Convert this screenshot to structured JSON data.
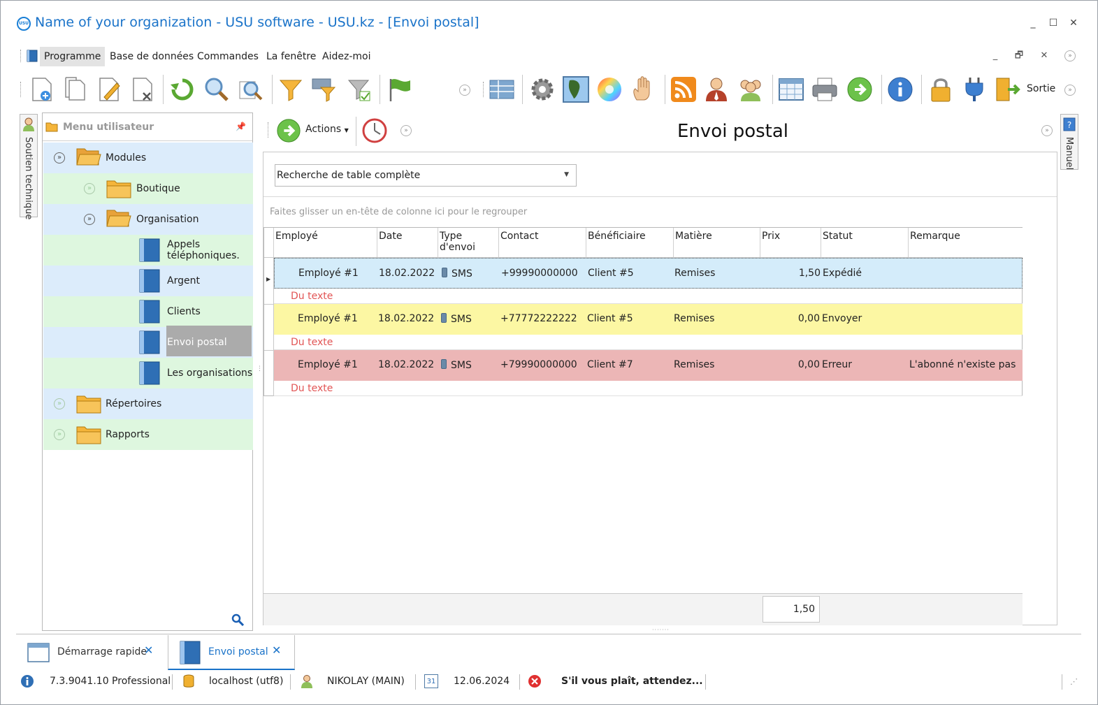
{
  "window": {
    "title": "Name of your organization - USU software - USU.kz - [Envoi postal]",
    "logo_text": "USU"
  },
  "menu": {
    "items": [
      "Programme",
      "Base de données",
      "Commandes",
      "La fenêtre",
      "Aidez-moi"
    ]
  },
  "toolbar": {
    "exit_label": "Sortie"
  },
  "side_tabs": {
    "support": "Soutien technique",
    "manual": "Manuel"
  },
  "nav": {
    "header": "Menu utilisateur",
    "modules": "Modules",
    "boutique": "Boutique",
    "organisation": "Organisation",
    "appels_line1": "Appels",
    "appels_line2": "téléphoniques.",
    "argent": "Argent",
    "clients": "Clients",
    "envoi_postal": "Envoi postal",
    "les_organisations": "Les organisations",
    "repertoires": "Répertoires",
    "rapports": "Rapports"
  },
  "main": {
    "actions_label": "Actions",
    "title": "Envoi postal",
    "search_combo": "Recherche de table complète",
    "group_hint": "Faites glisser un en-tête de colonne ici pour le regrouper",
    "columns": [
      "Employé",
      "Date",
      "Type d'envoi",
      "Contact",
      "Bénéficiaire",
      "Matière",
      "Prix",
      "Statut",
      "Remarque"
    ],
    "rows": [
      {
        "employe": "Employé #1",
        "date": "18.02.2022",
        "type": "SMS",
        "contact": "+99990000000",
        "beneficiaire": "Client #5",
        "matiere": "Remises",
        "prix": "1,50",
        "statut": "Expédié",
        "remarque": "",
        "texte": "Du texte"
      },
      {
        "employe": "Employé #1",
        "date": "18.02.2022",
        "type": "SMS",
        "contact": "+77772222222",
        "beneficiaire": "Client #5",
        "matiere": "Remises",
        "prix": "0,00",
        "statut": "Envoyer",
        "remarque": "",
        "texte": "Du texte"
      },
      {
        "employe": "Employé #1",
        "date": "18.02.2022",
        "type": "SMS",
        "contact": "+79990000000",
        "beneficiaire": "Client #7",
        "matiere": "Remises",
        "prix": "0,00",
        "statut": "Erreur",
        "remarque": "L'abonné n'existe pas",
        "texte": "Du texte"
      }
    ],
    "total": "1,50"
  },
  "tabs": [
    {
      "label": "Démarrage rapide"
    },
    {
      "label": "Envoi postal"
    }
  ],
  "status": {
    "version": "7.3.9041.10 Professional",
    "db": "localhost (utf8)",
    "user": "NIKOLAY (MAIN)",
    "calendar_day": "31",
    "date": "12.06.2024",
    "message": "S'il vous plaît, attendez..."
  },
  "colors": {
    "title_blue": "#1a73c9",
    "row_blue": "#d4ecfa",
    "row_yellow": "#fcf7a3",
    "row_red": "#ecb6b6",
    "remark_red": "#e25555"
  }
}
